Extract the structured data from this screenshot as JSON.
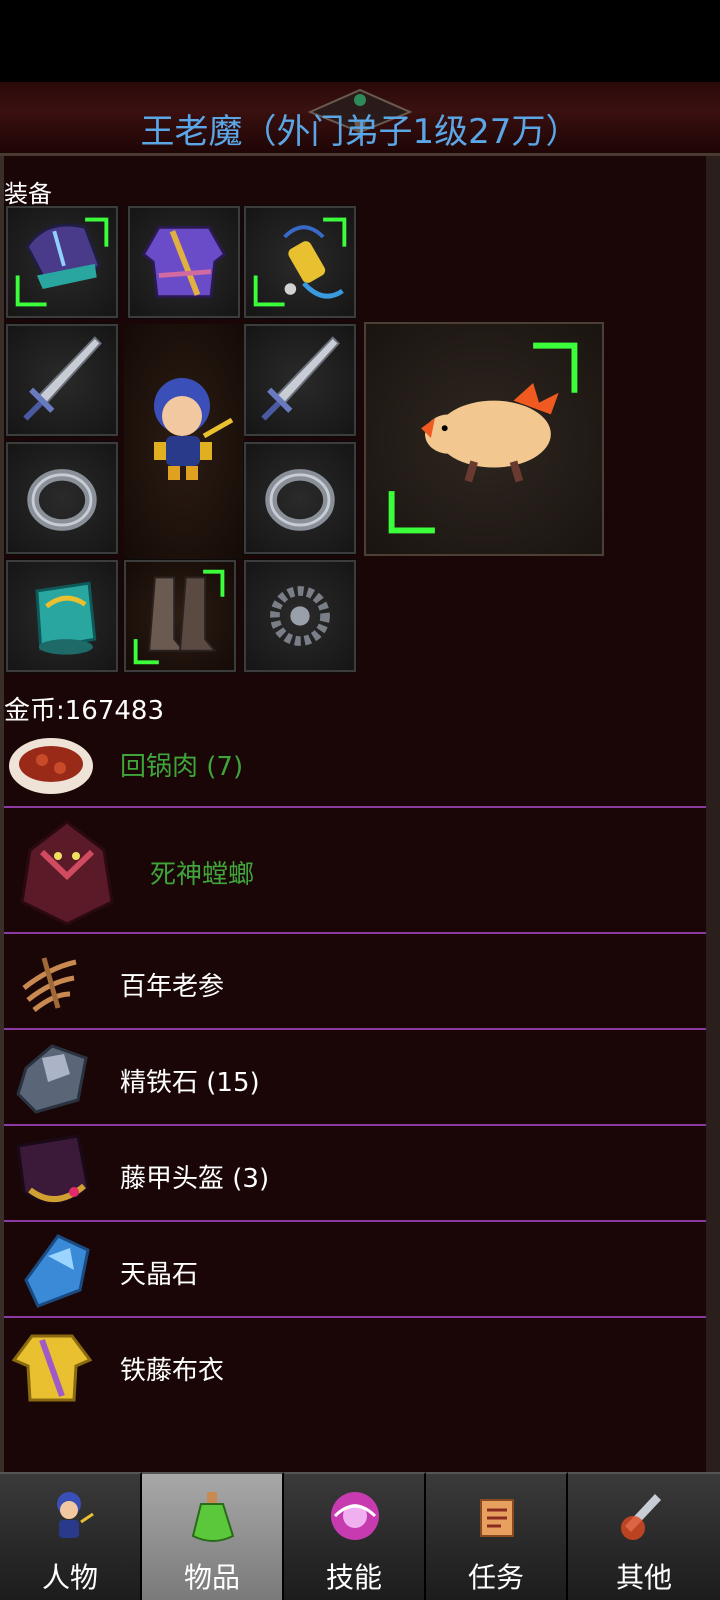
{
  "title": "王老魔（外门弟子1级27万）",
  "equipment_heading": "装备",
  "gold": "金币:167483",
  "equipment_slots": [
    {
      "name": "shoulder-armor-icon"
    },
    {
      "name": "robe-icon"
    },
    {
      "name": "accessory-icon"
    },
    {
      "name": "sword-icon"
    },
    {
      "name": "sword-icon"
    },
    {
      "name": "ring-icon"
    },
    {
      "name": "ring-icon"
    },
    {
      "name": "bracer-icon"
    },
    {
      "name": "boots-icon"
    },
    {
      "name": "bead-necklace-icon"
    }
  ],
  "pet": {
    "name": "fire-salamander-icon"
  },
  "items": [
    {
      "label": "回锅肉 (7)",
      "icon": "braised-pork-icon",
      "color": "#3fa43a"
    },
    {
      "label": "死神螳螂",
      "icon": "mantis-icon",
      "color": "#3fa43a"
    },
    {
      "label": "百年老参",
      "icon": "ginseng-icon",
      "color": "#ffffff"
    },
    {
      "label": "精铁石 (15)",
      "icon": "iron-ore-icon",
      "color": "#ffffff"
    },
    {
      "label": "藤甲头盔 (3)",
      "icon": "helmet-icon",
      "color": "#ffffff"
    },
    {
      "label": "天晶石",
      "icon": "crystal-icon",
      "color": "#ffffff"
    },
    {
      "label": "铁藤布衣",
      "icon": "cloth-armor-icon",
      "color": "#ffffff"
    }
  ],
  "tabs": [
    {
      "label": "人物",
      "icon": "character-icon",
      "active": false
    },
    {
      "label": "物品",
      "icon": "potion-icon",
      "active": true
    },
    {
      "label": "技能",
      "icon": "skill-orb-icon",
      "active": false
    },
    {
      "label": "任务",
      "icon": "quest-scroll-icon",
      "active": false
    },
    {
      "label": "其他",
      "icon": "misc-sword-icon",
      "active": false
    }
  ],
  "colors": {
    "title": "#5aa6e6",
    "rare_item": "#3fa43a",
    "divider": "#8b3aa0",
    "glow": "#3cff3c"
  }
}
